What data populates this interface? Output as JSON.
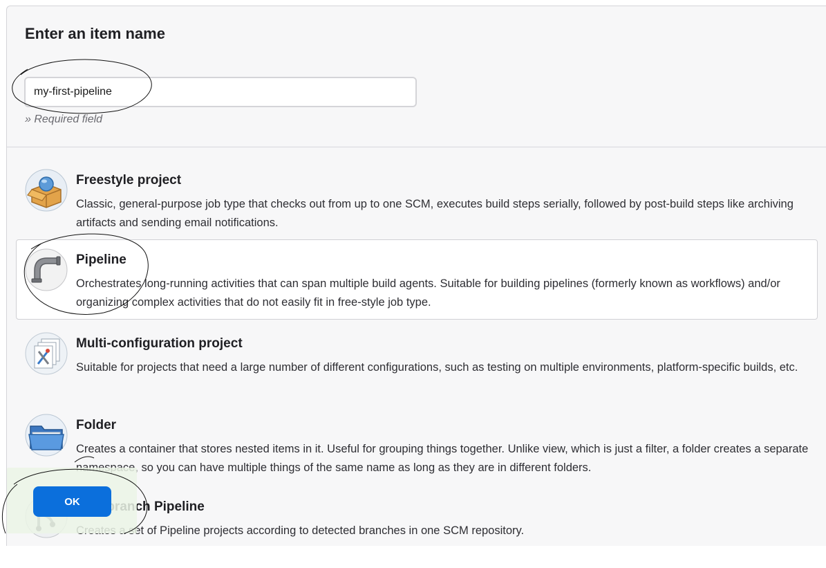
{
  "form": {
    "title": "Enter an item name",
    "item_name_value": "my-first-pipeline",
    "required_hint": "» Required field"
  },
  "item_types": [
    {
      "title": "Freestyle project",
      "description": "Classic, general-purpose job type that checks out from up to one SCM, executes build steps serially, followed by post-build steps like archiving artifacts and sending email notifications.",
      "icon": "freestyle-project-icon"
    },
    {
      "title": "Pipeline",
      "description": "Orchestrates long-running activities that can span multiple build agents. Suitable for building pipelines (formerly known as workflows) and/or organizing complex activities that do not easily fit in free-style job type.",
      "icon": "pipeline-icon",
      "selected": true
    },
    {
      "title": "Multi-configuration project",
      "description": "Suitable for projects that need a large number of different configurations, such as testing on multiple environments, platform-specific builds, etc.",
      "icon": "multi-configuration-icon"
    },
    {
      "title": "Folder",
      "description": "Creates a container that stores nested items in it. Useful for grouping things together. Unlike view, which is just a filter, a folder creates a separate namespace, so you can have multiple things of the same name as long as they are in different folders.",
      "icon": "folder-icon"
    },
    {
      "title": "Multibranch Pipeline",
      "description": "Creates a set of Pipeline projects according to detected branches in one SCM repository.",
      "icon": "multibranch-pipeline-icon"
    }
  ],
  "actions": {
    "ok_label": "OK"
  },
  "colors": {
    "accent": "#0b6fdc",
    "panel_bg": "#f7f7f8",
    "selected_bg": "#ffffff"
  }
}
